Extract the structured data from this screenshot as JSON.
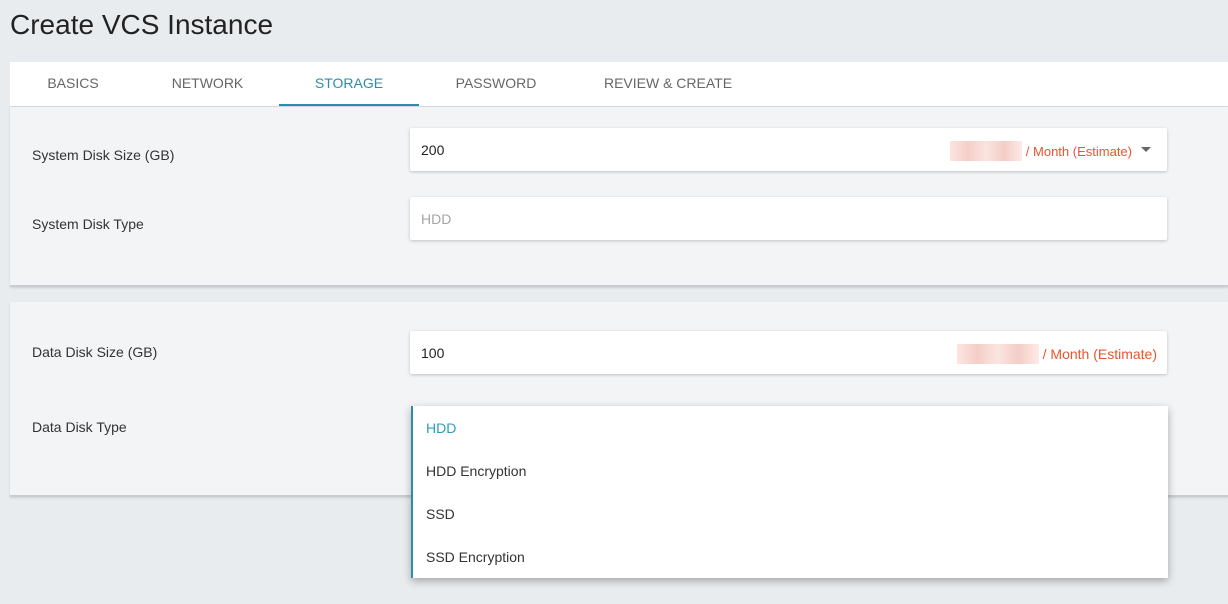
{
  "page_title": "Create VCS Instance",
  "tabs": [
    {
      "label": "BASICS",
      "active": false
    },
    {
      "label": "NETWORK",
      "active": false
    },
    {
      "label": "STORAGE",
      "active": true
    },
    {
      "label": "PASSWORD",
      "active": false
    },
    {
      "label": "REVIEW & CREATE",
      "active": false
    }
  ],
  "system_disk": {
    "size_label": "System Disk Size (GB)",
    "size_value": "200",
    "size_estimate": "/ Month (Estimate)",
    "type_label": "System Disk Type",
    "type_placeholder": "HDD"
  },
  "data_disk": {
    "size_label": "Data Disk Size (GB)",
    "size_value": "100",
    "size_estimate": "/ Month (Estimate)",
    "type_label": "Data Disk Type",
    "type_options": [
      "HDD",
      "HDD Encryption",
      "SSD",
      "SSD Encryption"
    ],
    "type_selected": "HDD"
  },
  "colors": {
    "accent": "#2a8ea8",
    "estimate": "#e8552c",
    "background": "#e9ecef"
  }
}
